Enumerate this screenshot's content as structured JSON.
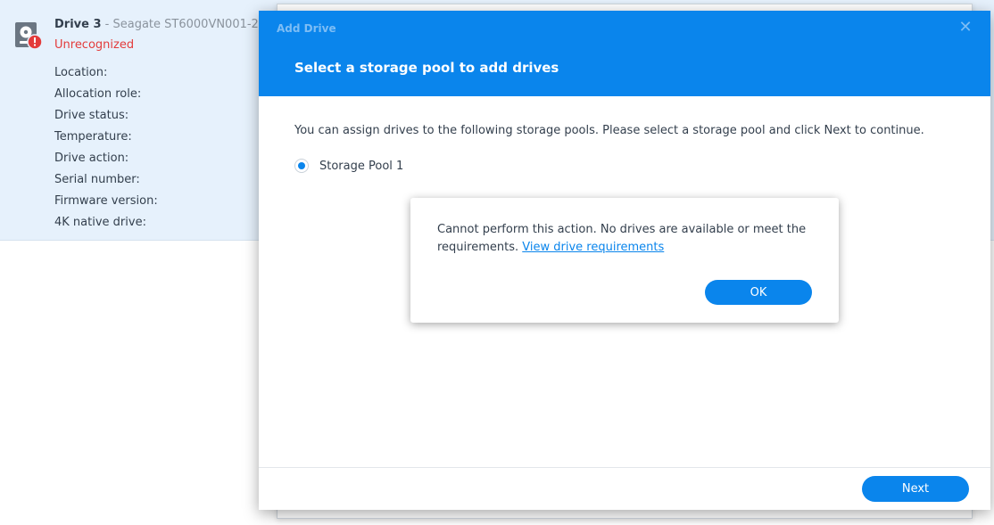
{
  "drive": {
    "name": "Drive 3",
    "separator": " - ",
    "model": "Seagate ST6000VN001-2",
    "state": "Unrecognized",
    "state_color": "#e33b3b",
    "icon": "hard-drive-warning-icon",
    "properties": [
      "Location:",
      "Allocation role:",
      "Drive status:",
      "Temperature:",
      "Drive action:",
      "Serial number:",
      "Firmware version:",
      "4K native drive:"
    ]
  },
  "dialog": {
    "window_title": "Add Drive",
    "close_icon": "close-icon",
    "heading": "Select a storage pool to add drives",
    "description": "You can assign drives to the following storage pools. Please select a storage pool and click Next to continue.",
    "pools": [
      {
        "label": "Storage Pool 1",
        "selected": true
      }
    ],
    "next_label": "Next",
    "accent_color": "#0a85ec"
  },
  "alert": {
    "message": "Cannot perform this action. No drives are available or meet the requirements.",
    "link_text": "View drive requirements",
    "ok_label": "OK"
  }
}
